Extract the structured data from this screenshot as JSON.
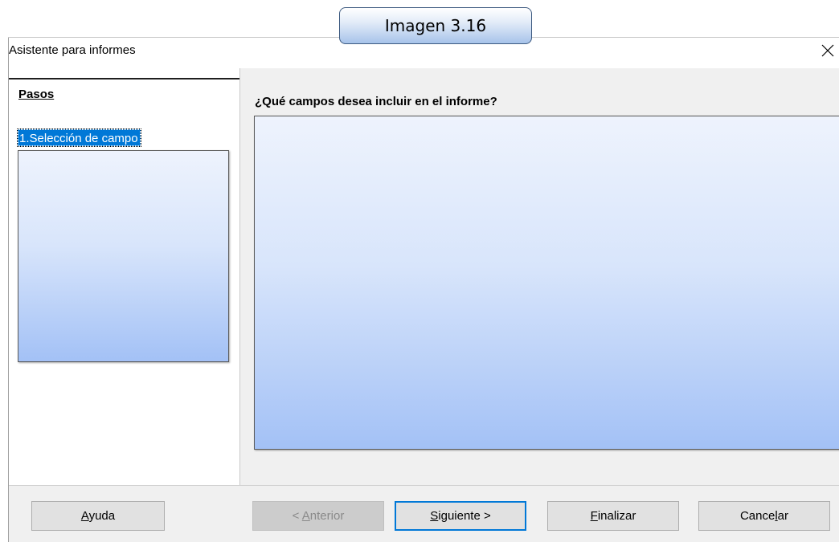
{
  "caption": {
    "text": "Imagen 3.16"
  },
  "window": {
    "title": "Asistente para informes",
    "close_glyph": "✕"
  },
  "steps": {
    "heading": "Pasos",
    "items": [
      {
        "label": "1.Selección de campo",
        "selected": true
      }
    ]
  },
  "content": {
    "question": "¿Qué campos desea incluir en el informe?"
  },
  "buttons": {
    "help": {
      "pre": "",
      "accel": "A",
      "post": "yuda"
    },
    "back": {
      "pre": "< ",
      "accel": "A",
      "post": "nterior",
      "enabled": false
    },
    "next": {
      "pre": "",
      "accel": "S",
      "post": "iguiente >",
      "default": true
    },
    "finish": {
      "pre": "",
      "accel": "F",
      "post": "inalizar"
    },
    "cancel": {
      "pre": "Cance",
      "accel": "l",
      "post": "ar"
    }
  },
  "colors": {
    "selection": "#0078d7",
    "panel_gradient_top": "#eef3fd",
    "panel_gradient_bottom": "#a3c1f6",
    "button_face": "#e1e1e1",
    "dialog_bg": "#f0f0f0"
  }
}
